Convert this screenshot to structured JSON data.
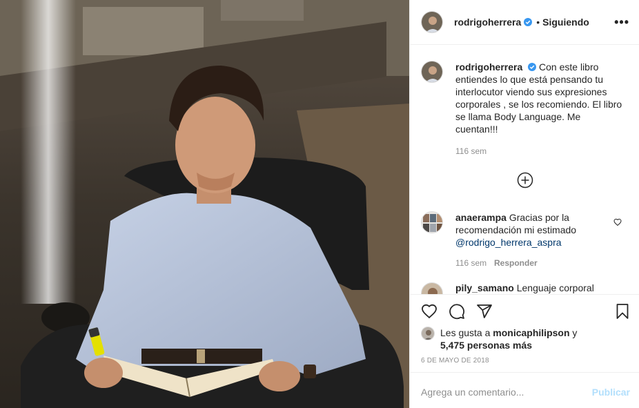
{
  "post": {
    "username": "rodrigoherrera",
    "follow_status": "Siguiendo",
    "dot": "•",
    "more_label": "•••",
    "caption": "Con este libro entiendes lo que está pensando tu interlocutor viendo sus expresiones corporales , se los recomiendo. El libro se llama Body Language. Me cuentan!!!",
    "caption_age": "116 sem",
    "date": "6 DE MAYO DE 2018"
  },
  "comments": [
    {
      "username": "anaerampa",
      "text": "Gracias por la recomendación mi estimado",
      "mention": "@rodrigo_herrera_aspra",
      "age": "116 sem",
      "reply_label": "Responder"
    },
    {
      "username": "pily_samano",
      "text": "Lenguaje corporal"
    }
  ],
  "likes": {
    "prefix": "Les gusta a",
    "user": "monicaphilipson",
    "connector": "y",
    "others": "5,475 personas más"
  },
  "add_comment": {
    "placeholder": "Agrega un comentario...",
    "publish_label": "Publicar"
  },
  "icons": {
    "verified": "verified-badge-icon",
    "more": "more-options-icon",
    "load_more": "plus-circle-icon",
    "like": "heart-icon",
    "comment": "comment-bubble-icon",
    "share": "paper-plane-icon",
    "save": "bookmark-icon"
  },
  "colors": {
    "verified": "#3897f0",
    "publish_disabled": "#b2dffc",
    "muted": "#8e8e8e",
    "mention": "#00376b"
  }
}
